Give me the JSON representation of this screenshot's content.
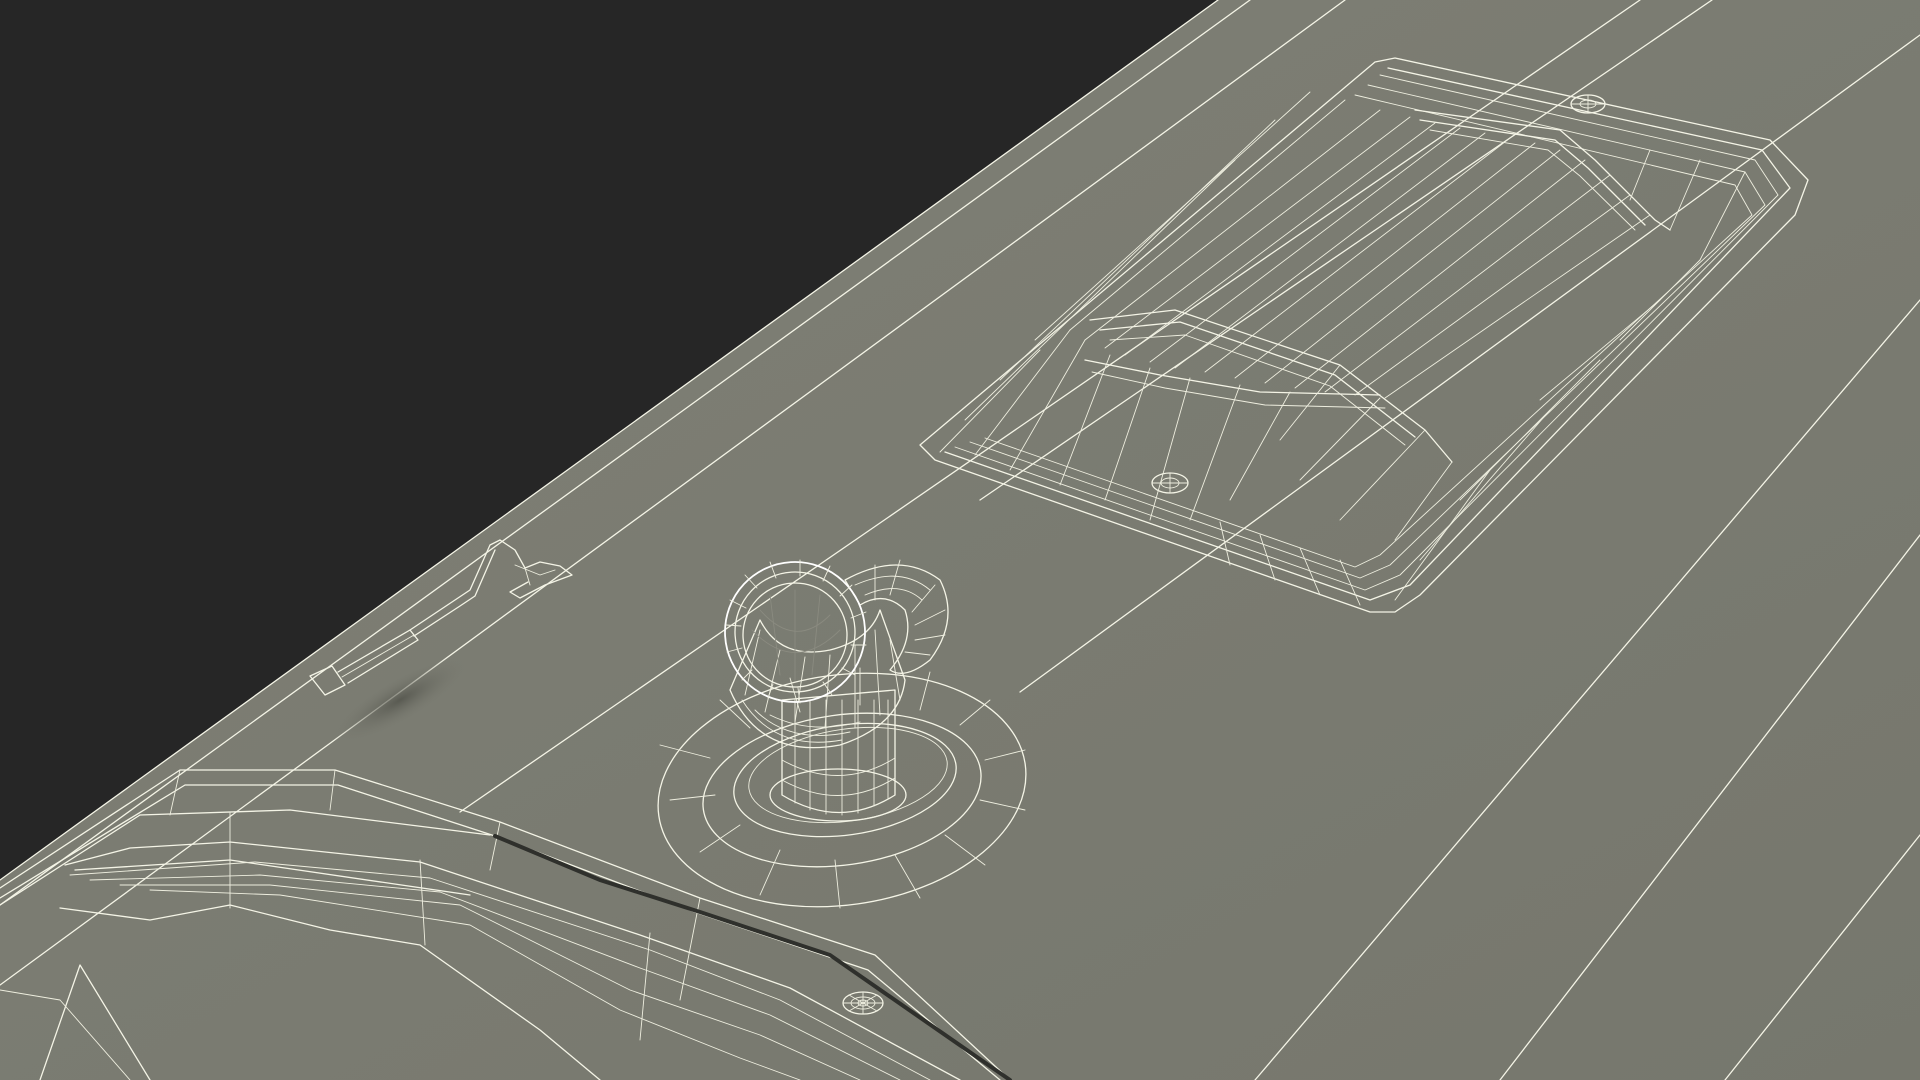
{
  "scene": {
    "kind": "3d-wireframe-render",
    "subject": "tank-top-panel",
    "colors": {
      "background": "#262626",
      "surface": "#7a7b71",
      "surface_light": "#84857b",
      "wire": "#f4f4e6",
      "shadow": "#5e5f57",
      "hole": "#2c2d29"
    },
    "objects": [
      {
        "name": "hatch-panel",
        "icon": "wireframe-hatch"
      },
      {
        "name": "filler-pipe",
        "icon": "wireframe-pipe"
      },
      {
        "name": "cable-antenna",
        "icon": "wireframe-cable"
      },
      {
        "name": "bolt-heads",
        "icon": "wireframe-bolt"
      },
      {
        "name": "raised-rim",
        "icon": "wireframe-rim"
      }
    ]
  }
}
